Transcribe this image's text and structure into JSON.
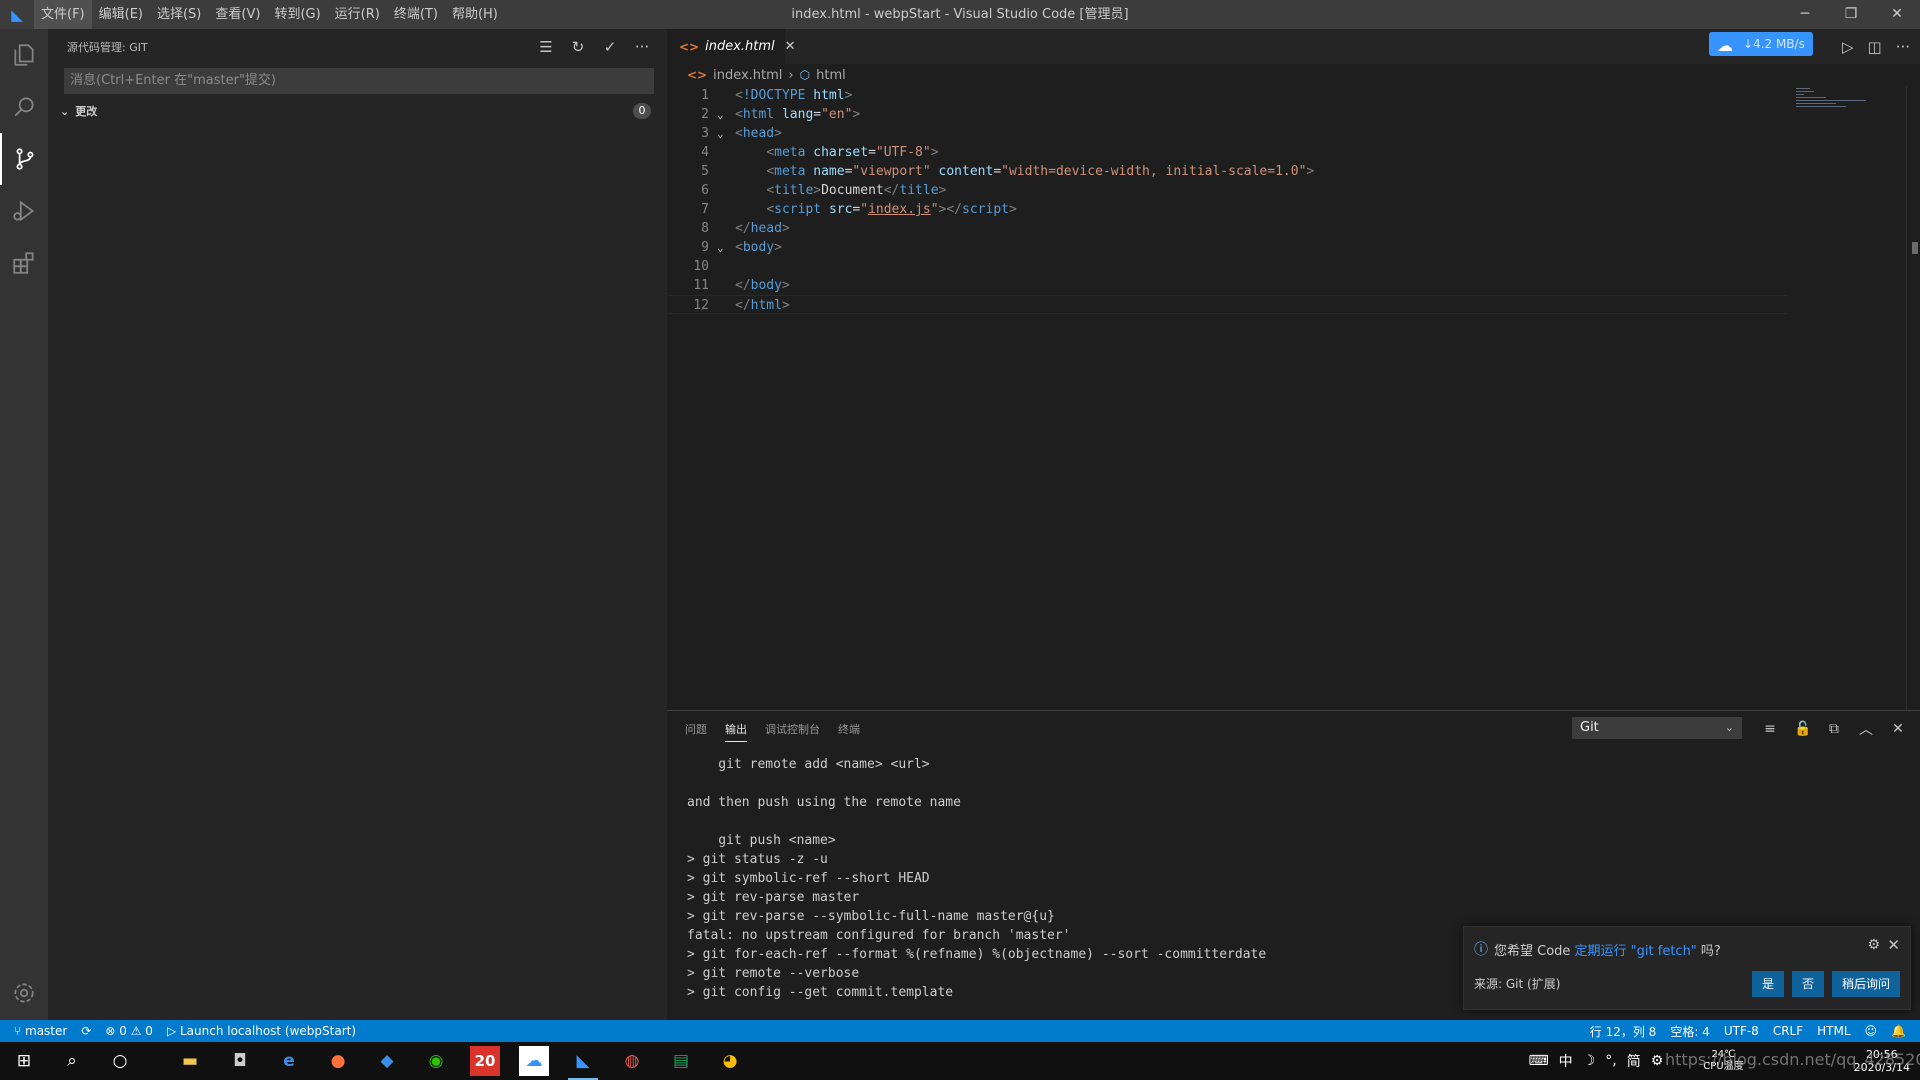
{
  "window": {
    "title": "index.html - webpStart - Visual Studio Code [管理员]",
    "menu": [
      "文件(F)",
      "编辑(E)",
      "选择(S)",
      "查看(V)",
      "转到(G)",
      "运行(R)",
      "终端(T)",
      "帮助(H)"
    ],
    "controls": {
      "minimize": "─",
      "restore": "❐",
      "close": "✕"
    }
  },
  "activity_bar": {
    "items": [
      {
        "name": "explorer-icon"
      },
      {
        "name": "search-icon"
      },
      {
        "name": "source-control-icon",
        "active": true
      },
      {
        "name": "run-debug-icon"
      },
      {
        "name": "extensions-icon"
      }
    ],
    "settings_icon": "gear-icon"
  },
  "sidebar": {
    "header": "源代码管理: GIT",
    "actions": [
      {
        "name": "view-as-tree-icon",
        "glyph": "☰"
      },
      {
        "name": "refresh-icon",
        "glyph": "↻"
      },
      {
        "name": "commit-check-icon",
        "glyph": "✓"
      },
      {
        "name": "more-actions-icon",
        "glyph": "···"
      }
    ],
    "commit_placeholder": "消息(Ctrl+Enter 在\"master\"提交)",
    "changes_label": "更改",
    "changes_count": "0"
  },
  "editor": {
    "tab_label": "index.html",
    "tab_close": "✕",
    "breadcrumb": {
      "file": "index.html",
      "separator": "›",
      "element": "html"
    },
    "network_speed": "↓4.2 MB/s",
    "actions": [
      {
        "name": "run-icon",
        "glyph": "▷"
      },
      {
        "name": "split-editor-icon",
        "glyph": "◫"
      },
      {
        "name": "editor-more-icon",
        "glyph": "···"
      }
    ],
    "lines": [
      {
        "n": "1",
        "fold": "",
        "tokens": [
          [
            "t-punc",
            "<"
          ],
          [
            "t-tag",
            "!DOCTYPE"
          ],
          [
            "t-text",
            " "
          ],
          [
            "t-attr",
            "html"
          ],
          [
            "t-punc",
            ">"
          ]
        ]
      },
      {
        "n": "2",
        "fold": "⌄",
        "tokens": [
          [
            "t-punc",
            "<"
          ],
          [
            "t-tag",
            "html"
          ],
          [
            "t-text",
            " "
          ],
          [
            "t-attr",
            "lang"
          ],
          [
            "t-text",
            "="
          ],
          [
            "t-str",
            "\"en\""
          ],
          [
            "t-punc",
            ">"
          ]
        ]
      },
      {
        "n": "3",
        "fold": "⌄",
        "tokens": [
          [
            "t-punc",
            "<"
          ],
          [
            "t-tag",
            "head"
          ],
          [
            "t-punc",
            ">"
          ]
        ]
      },
      {
        "n": "4",
        "fold": "",
        "tokens": [
          [
            "t-text",
            "    "
          ],
          [
            "t-punc",
            "<"
          ],
          [
            "t-tag",
            "meta"
          ],
          [
            "t-text",
            " "
          ],
          [
            "t-attr",
            "charset"
          ],
          [
            "t-text",
            "="
          ],
          [
            "t-str",
            "\"UTF-8\""
          ],
          [
            "t-punc",
            ">"
          ]
        ]
      },
      {
        "n": "5",
        "fold": "",
        "tokens": [
          [
            "t-text",
            "    "
          ],
          [
            "t-punc",
            "<"
          ],
          [
            "t-tag",
            "meta"
          ],
          [
            "t-text",
            " "
          ],
          [
            "t-attr",
            "name"
          ],
          [
            "t-text",
            "="
          ],
          [
            "t-str",
            "\"viewport\""
          ],
          [
            "t-text",
            " "
          ],
          [
            "t-attr",
            "content"
          ],
          [
            "t-text",
            "="
          ],
          [
            "t-str",
            "\"width=device-width, initial-scale=1.0\""
          ],
          [
            "t-punc",
            ">"
          ]
        ]
      },
      {
        "n": "6",
        "fold": "",
        "tokens": [
          [
            "t-text",
            "    "
          ],
          [
            "t-punc",
            "<"
          ],
          [
            "t-tag",
            "title"
          ],
          [
            "t-punc",
            ">"
          ],
          [
            "t-text",
            "Document"
          ],
          [
            "t-punc",
            "</"
          ],
          [
            "t-tag",
            "title"
          ],
          [
            "t-punc",
            ">"
          ]
        ]
      },
      {
        "n": "7",
        "fold": "",
        "tokens": [
          [
            "t-text",
            "    "
          ],
          [
            "t-punc",
            "<"
          ],
          [
            "t-tag",
            "script"
          ],
          [
            "t-text",
            " "
          ],
          [
            "t-attr",
            "src"
          ],
          [
            "t-text",
            "="
          ],
          [
            "t-str",
            "\""
          ],
          [
            "t-link",
            "index.js"
          ],
          [
            "t-str",
            "\""
          ],
          [
            "t-punc",
            "></"
          ],
          [
            "t-tag",
            "script"
          ],
          [
            "t-punc",
            ">"
          ]
        ]
      },
      {
        "n": "8",
        "fold": "",
        "tokens": [
          [
            "t-punc",
            "</"
          ],
          [
            "t-tag",
            "head"
          ],
          [
            "t-punc",
            ">"
          ]
        ]
      },
      {
        "n": "9",
        "fold": "⌄",
        "tokens": [
          [
            "t-punc",
            "<"
          ],
          [
            "t-tag",
            "body"
          ],
          [
            "t-punc",
            ">"
          ]
        ]
      },
      {
        "n": "10",
        "fold": "",
        "tokens": [
          [
            "t-text",
            " "
          ]
        ]
      },
      {
        "n": "11",
        "fold": "",
        "tokens": [
          [
            "t-punc",
            "</"
          ],
          [
            "t-tag",
            "body"
          ],
          [
            "t-punc",
            ">"
          ]
        ]
      },
      {
        "n": "12",
        "fold": "",
        "tokens": [
          [
            "t-punc",
            "</"
          ],
          [
            "t-tag",
            "html"
          ],
          [
            "t-punc",
            ">"
          ]
        ],
        "current": true
      }
    ]
  },
  "panel": {
    "tabs": [
      {
        "label": "问题",
        "active": false
      },
      {
        "label": "输出",
        "active": true
      },
      {
        "label": "调试控制台",
        "active": false
      },
      {
        "label": "终端",
        "active": false
      }
    ],
    "output_channel": "Git",
    "actions": [
      {
        "name": "clear-output-icon",
        "glyph": "≡"
      },
      {
        "name": "lock-scroll-icon",
        "glyph": "🔓"
      },
      {
        "name": "open-log-icon",
        "glyph": "⧉"
      },
      {
        "name": "maximize-panel-icon",
        "glyph": "︿"
      },
      {
        "name": "close-panel-icon",
        "glyph": "✕"
      }
    ],
    "output_lines": [
      "    git remote add <name> <url>",
      "",
      "and then push using the remote name",
      "",
      "    git push <name>",
      "> git status -z -u",
      "> git symbolic-ref --short HEAD",
      "> git rev-parse master",
      "> git rev-parse --symbolic-full-name master@{u}",
      "fatal: no upstream configured for branch 'master'",
      "> git for-each-ref --format %(refname) %(objectname) --sort -committerdate",
      "> git remote --verbose",
      "> git config --get commit.template"
    ]
  },
  "notification": {
    "prefix": "您希望 Code ",
    "link": "定期运行 \"git fetch\"",
    "suffix": " 吗?",
    "source": "来源: Git (扩展)",
    "buttons": [
      "是",
      "否",
      "稍后询问"
    ]
  },
  "status_bar": {
    "branch": "master",
    "sync": "⟳",
    "problems": "⊗ 0 ⚠ 0",
    "launch": "▷ Launch localhost (webpStart)",
    "position": "行 12，列 8",
    "spaces": "空格: 4",
    "encoding": "UTF-8",
    "eol": "CRLF",
    "language": "HTML",
    "feedback": "☺",
    "bell": "🔔"
  },
  "taskbar": {
    "icons": [
      "windows-start-icon",
      "search-icon",
      "cortana-icon",
      "file-explorer-icon",
      "store-icon",
      "edge-icon",
      "firefox-icon",
      "app-bird-icon",
      "wechat-icon",
      "app-20-icon",
      "baidu-netdisk-icon",
      "vscode-icon",
      "app-red-icon",
      "sheets-icon",
      "chrome-icon"
    ],
    "app20_label": "20",
    "tray_items": [
      "⌨",
      "中",
      "☽",
      "°,",
      "简",
      "⚙"
    ],
    "weather": {
      "temp": "24℃",
      "label": "CPU温度"
    },
    "clock": {
      "time": "20:56",
      "date": "2020/3/14"
    },
    "watermark": "https://blog.csdn.net/qq_42852004"
  },
  "colors": {
    "accent": "#007acc",
    "editor_bg": "#1e1e1e",
    "sidebar_bg": "#252526",
    "activity_bg": "#333333",
    "titlebar_bg": "#3c3c3c"
  }
}
